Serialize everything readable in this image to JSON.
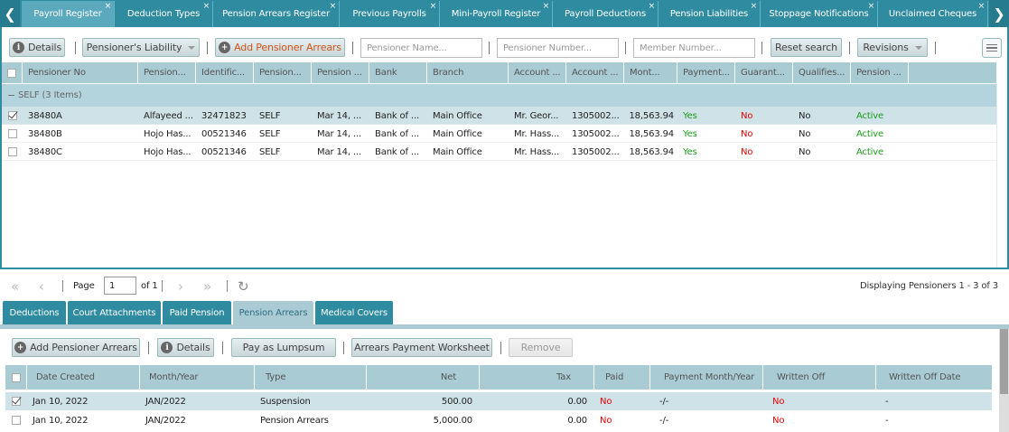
{
  "tabs": [
    {
      "label": "Payroll Register"
    },
    {
      "label": "Deduction Types"
    },
    {
      "label": "Pension Arrears Register"
    },
    {
      "label": "Previous Payrolls"
    },
    {
      "label": "Mini-Payroll Register"
    },
    {
      "label": "Payroll Deductions"
    },
    {
      "label": "Pension Liabilities"
    },
    {
      "label": "Stoppage Notifications"
    },
    {
      "label": "Unclaimed Cheques"
    }
  ],
  "nav": {
    "prev": "❮",
    "next": "❯",
    "close": "×"
  },
  "toolbar": {
    "details": "Details",
    "liability": "Pensioner's Liability",
    "add_arrears": "Add Pensioner Arrears",
    "name_placeholder": "Pensioner Name...",
    "number_placeholder": "Pensioner Number...",
    "member_placeholder": "Member Number...",
    "reset": "Reset search",
    "revisions": "Revisions"
  },
  "grid": {
    "columns": [
      "Pensioner No",
      "Pension...",
      "Identific...",
      "Pension...",
      "Pension ...",
      "Bank",
      "Branch",
      "Account ...",
      "Account ...",
      "Mont...",
      "Payment...",
      "Guarant...",
      "Qualifies...",
      "Pension ..."
    ],
    "group": "SELF (3 Items)",
    "rows": [
      {
        "no": "38480A",
        "name": "Alfayeed ...",
        "id": "32471823",
        "type": "SELF",
        "date": "Mar 14, ...",
        "bank": "Bank of ...",
        "branch": "Main Office",
        "acct_name": "Mr. Geor...",
        "acct_no": "1305002...",
        "monthly": "18,563.94",
        "payment": "Yes",
        "guarantee": "No",
        "qualifies": "No",
        "status": "Active"
      },
      {
        "no": "38480B",
        "name": "Hojo Has...",
        "id": "00521346",
        "type": "SELF",
        "date": "Mar 14, ...",
        "bank": "Bank of ...",
        "branch": "Main Office",
        "acct_name": "Mr. Hass...",
        "acct_no": "1305002...",
        "monthly": "18,563.94",
        "payment": "Yes",
        "guarantee": "No",
        "qualifies": "No",
        "status": "Active"
      },
      {
        "no": "38480C",
        "name": "Hojo Has...",
        "id": "00521346",
        "type": "SELF",
        "date": "Mar 14, ...",
        "bank": "Bank of ...",
        "branch": "Main Office",
        "acct_name": "Mr. Hass...",
        "acct_no": "1305002...",
        "monthly": "18,563.94",
        "payment": "Yes",
        "guarantee": "No",
        "qualifies": "No",
        "status": "Active"
      }
    ]
  },
  "pager": {
    "page_label": "Page",
    "page_value": "1",
    "of_label": "of 1",
    "display": "Displaying Pensioners 1 - 3 of 3"
  },
  "subtabs": [
    {
      "label": "Deductions"
    },
    {
      "label": "Court Attachments"
    },
    {
      "label": "Paid Pension"
    },
    {
      "label": "Pension Arrears"
    },
    {
      "label": "Medical Covers"
    }
  ],
  "sub_toolbar": {
    "add_arrears": "Add Pensioner Arrears",
    "details": "Details",
    "lumpsum": "Pay as Lumpsum",
    "worksheet": "Arrears Payment Worksheet",
    "remove": "Remove"
  },
  "arrears": {
    "columns": [
      "Date Created",
      "Month/Year",
      "Type",
      "Net",
      "Tax",
      "Paid",
      "Payment Month/Year",
      "Written Off",
      "Written Off Date"
    ],
    "rows": [
      {
        "date": "Jan 10, 2022",
        "month": "JAN/2022",
        "type": "Suspension",
        "net": "500.00",
        "tax": "0.00",
        "paid": "No",
        "pay_month": "-/-",
        "written_off": "No",
        "wo_date": "-"
      },
      {
        "date": "Jan 10, 2022",
        "month": "JAN/2022",
        "type": "Pension Arrears",
        "net": "5,000.00",
        "tax": "0.00",
        "paid": "No",
        "pay_month": "-/-",
        "written_off": "No",
        "wo_date": "-"
      }
    ]
  },
  "colors": {
    "accent": "#2e8ba0",
    "header": "#a8cbd4",
    "group": "#b4d4dd",
    "selected": "#cfe2e7",
    "yes": "#1a9b1a",
    "no": "#e00000"
  }
}
